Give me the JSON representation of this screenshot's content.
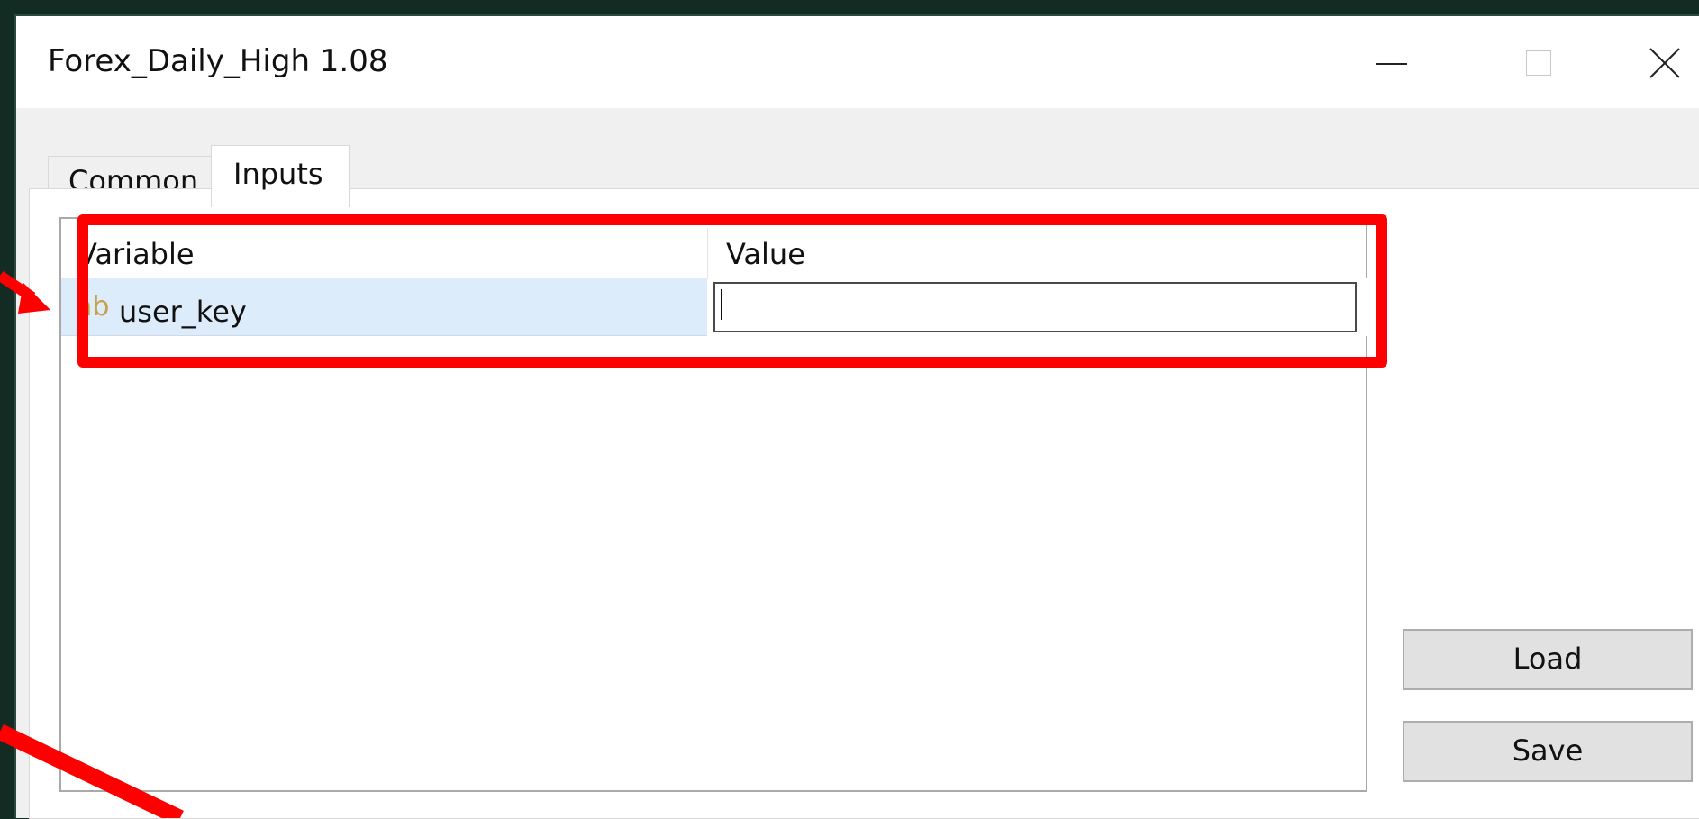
{
  "window": {
    "title": "Forex_Daily_High 1.08"
  },
  "tabs": [
    {
      "label": "Common",
      "active": false
    },
    {
      "label": "Inputs",
      "active": true
    }
  ],
  "grid": {
    "columns": [
      "Variable",
      "Value"
    ],
    "rows": [
      {
        "type_icon": "ab",
        "variable": "user_key",
        "value": ""
      }
    ]
  },
  "buttons": {
    "load_label": "Load",
    "save_label": "Save"
  },
  "colors": {
    "highlight": "#ff0000",
    "selected_row": "#ddecfa",
    "type_icon": "#c8a24a",
    "background": "#122b23"
  },
  "icons": {
    "minimize": "minimize-icon",
    "maximize": "maximize-icon",
    "close": "close-icon",
    "type": "string-type-icon"
  }
}
